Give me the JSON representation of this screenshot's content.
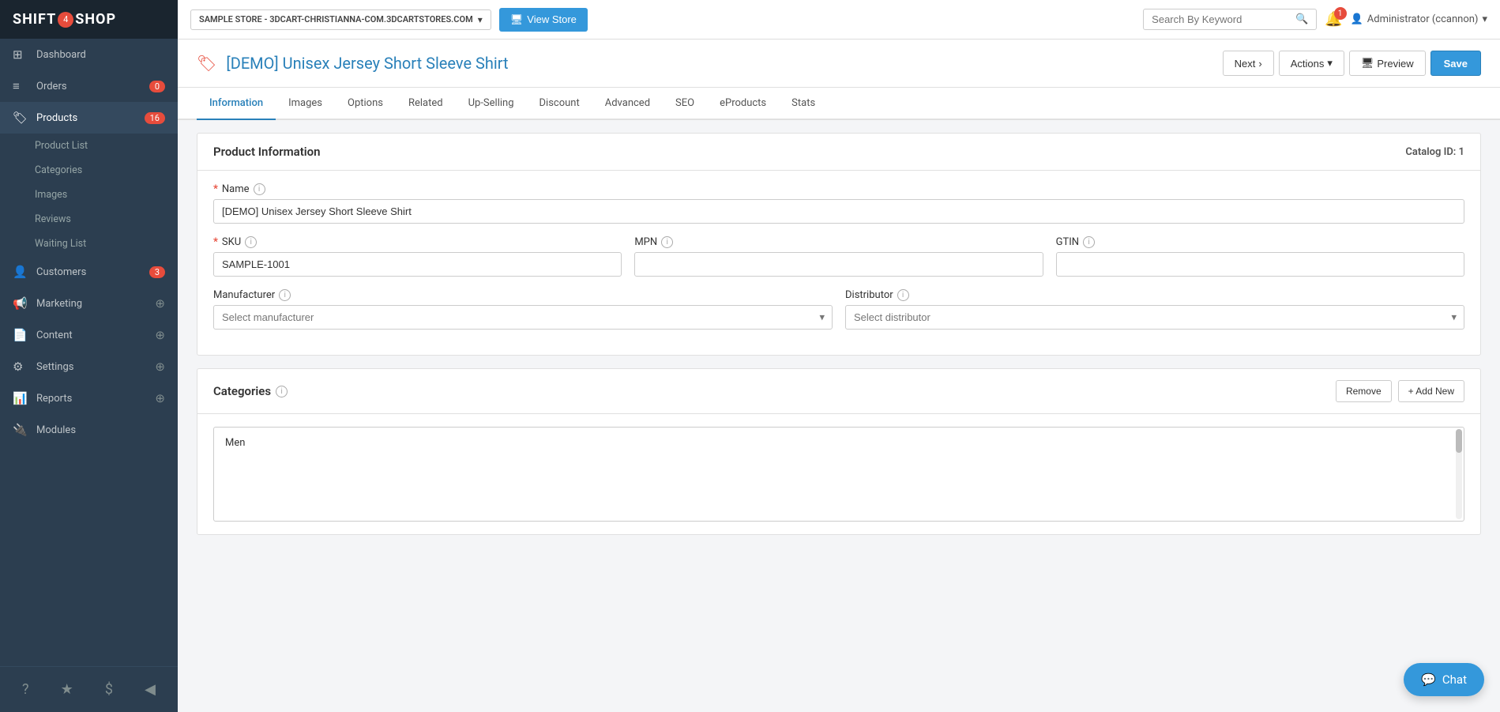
{
  "sidebar": {
    "logo": "SHIFT4SHOP",
    "logo_badge": "4",
    "items": [
      {
        "id": "dashboard",
        "label": "Dashboard",
        "icon": "⊞",
        "badge": null
      },
      {
        "id": "orders",
        "label": "Orders",
        "icon": "📋",
        "badge": "0"
      },
      {
        "id": "products",
        "label": "Products",
        "icon": "🏷",
        "badge": "16",
        "active": true
      },
      {
        "id": "customers",
        "label": "Customers",
        "icon": "👥",
        "badge": "3"
      },
      {
        "id": "marketing",
        "label": "Marketing",
        "icon": "📢",
        "badge_plus": "+"
      },
      {
        "id": "content",
        "label": "Content",
        "icon": "📄",
        "badge_plus": "+"
      },
      {
        "id": "settings",
        "label": "Settings",
        "icon": "⚙",
        "badge_plus": "+"
      },
      {
        "id": "reports",
        "label": "Reports",
        "icon": "📊",
        "badge_plus": "+"
      },
      {
        "id": "modules",
        "label": "Modules",
        "icon": "🔌"
      }
    ],
    "sub_items": [
      {
        "label": "Product List"
      },
      {
        "label": "Categories"
      },
      {
        "label": "Images"
      },
      {
        "label": "Reviews"
      },
      {
        "label": "Waiting List"
      }
    ],
    "bottom_icons": [
      "?",
      "★",
      "$"
    ]
  },
  "topbar": {
    "store_label": "SAMPLE STORE - 3DCART-CHRISTIANNA-COM.3DCARTSTORES.COM",
    "view_store_label": "View Store",
    "search_placeholder": "Search By Keyword",
    "notification_count": "1",
    "admin_label": "Administrator (ccannon)"
  },
  "page": {
    "title": "[DEMO] Unisex Jersey Short Sleeve Shirt",
    "btn_next": "Next",
    "btn_actions": "Actions",
    "btn_preview": "Preview",
    "btn_save": "Save"
  },
  "tabs": [
    {
      "id": "information",
      "label": "Information",
      "active": true
    },
    {
      "id": "images",
      "label": "Images"
    },
    {
      "id": "options",
      "label": "Options"
    },
    {
      "id": "related",
      "label": "Related"
    },
    {
      "id": "upselling",
      "label": "Up-Selling"
    },
    {
      "id": "discount",
      "label": "Discount"
    },
    {
      "id": "advanced",
      "label": "Advanced"
    },
    {
      "id": "seo",
      "label": "SEO"
    },
    {
      "id": "eproducts",
      "label": "eProducts"
    },
    {
      "id": "stats",
      "label": "Stats"
    }
  ],
  "product_info": {
    "section_title": "Product Information",
    "catalog_id": "Catalog ID: 1",
    "name_label": "Name",
    "name_value": "[DEMO] Unisex Jersey Short Sleeve Shirt",
    "sku_label": "SKU",
    "sku_value": "SAMPLE-1001",
    "mpn_label": "MPN",
    "mpn_value": "",
    "gtin_label": "GTIN",
    "gtin_value": "",
    "manufacturer_label": "Manufacturer",
    "manufacturer_placeholder": "Select manufacturer",
    "distributor_label": "Distributor",
    "distributor_placeholder": "Select distributor"
  },
  "categories": {
    "section_title": "Categories",
    "btn_remove": "Remove",
    "btn_add_new": "+ Add New",
    "items": [
      "Men"
    ]
  },
  "chat": {
    "label": "Chat"
  }
}
